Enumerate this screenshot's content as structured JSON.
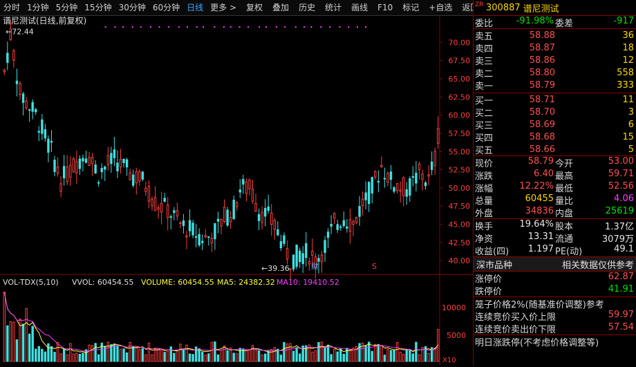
{
  "toolbar": {
    "periods": [
      "分时",
      "1分钟",
      "5分钟",
      "15分钟",
      "30分钟",
      "60分钟",
      "日线",
      "更多 >"
    ],
    "active_index": 6,
    "actions": [
      "复权",
      "叠加",
      "历史",
      "统计",
      "画线",
      "F10",
      "标记",
      "+自选",
      "返回"
    ]
  },
  "chart": {
    "title": "谱尼测试(日线,前复权)",
    "high_label": "72.44",
    "low_label": "39.36",
    "price_ticks": [
      "70.00",
      "67.50",
      "65.00",
      "62.50",
      "60.00",
      "57.50",
      "55.00",
      "52.50",
      "50.00",
      "47.50",
      "45.00",
      "42.50",
      "40.00"
    ],
    "marker_cai": "财",
    "marker_s": "S",
    "colors": {
      "up": "#ff4040",
      "down": "#40e0e0",
      "ma5": "#ffff40",
      "ma10": "#ff40ff",
      "axis": "#8b0000"
    }
  },
  "volume": {
    "indicator": "VOL-TDX(5,10)",
    "vvol_label": "VVOL: 60454.55",
    "volume_label": "VOLUME: 60454.55",
    "ma5_label": "MA5: 24382.32",
    "ma10_label": "MA10: 19410.52",
    "ticks": [
      "10000",
      "5000"
    ],
    "unit": "X10"
  },
  "quote": {
    "zr": "ZR",
    "code": "300887",
    "name": "谱尼测试",
    "weibi_label": "委比",
    "weibi_value": "-91.98%",
    "weicha_label": "委差",
    "weicha_value": "-917",
    "asks": [
      {
        "label": "卖五",
        "price": "58.88",
        "vol": "36"
      },
      {
        "label": "卖四",
        "price": "58.87",
        "vol": "18"
      },
      {
        "label": "卖三",
        "price": "58.86",
        "vol": "12"
      },
      {
        "label": "卖二",
        "price": "58.80",
        "vol": "558"
      },
      {
        "label": "卖一",
        "price": "58.79",
        "vol": "333"
      }
    ],
    "bids": [
      {
        "label": "买一",
        "price": "58.71",
        "vol": "11"
      },
      {
        "label": "买二",
        "price": "58.70",
        "vol": "3"
      },
      {
        "label": "买三",
        "price": "58.69",
        "vol": "6"
      },
      {
        "label": "买四",
        "price": "58.68",
        "vol": "15"
      },
      {
        "label": "买五",
        "price": "58.66",
        "vol": "5"
      }
    ],
    "stats1": [
      {
        "l": "现价",
        "lv": "58.79",
        "lc": "red",
        "r": "今开",
        "rv": "53.00",
        "rc": "red"
      },
      {
        "l": "涨跌",
        "lv": "6.40",
        "lc": "red",
        "r": "最高",
        "rv": "59.71",
        "rc": "red"
      },
      {
        "l": "涨幅",
        "lv": "12.22%",
        "lc": "red",
        "r": "最低",
        "rv": "52.56",
        "rc": "red"
      },
      {
        "l": "总量",
        "lv": "60455",
        "lc": "yellow",
        "r": "量比",
        "rv": "4.06",
        "rc": "magenta"
      },
      {
        "l": "外盘",
        "lv": "34836",
        "lc": "red",
        "r": "内盘",
        "rv": "25619",
        "rc": "green"
      }
    ],
    "stats2": [
      {
        "l": "换手",
        "lv": "19.64%",
        "r": "股本",
        "rv": "1.37亿"
      },
      {
        "l": "净资",
        "lv": "13.31",
        "r": "流通",
        "rv": "3079万"
      },
      {
        "l": "收益(四)",
        "lv": "1.197",
        "r": "PE(动)",
        "rv": "49.1"
      }
    ],
    "band_left": "深市品种",
    "band_right": "相关数据仅供参考",
    "limit_up_label": "涨停价",
    "limit_up": "62.87",
    "limit_down_label": "跌停价",
    "limit_down": "41.91",
    "cage_label": "笼子价格2%(随基准价调整)参考",
    "bid_limit_label": "连续竞价买入价上限",
    "bid_limit": "59.97",
    "ask_limit_label": "连续竞价卖出价下限",
    "ask_limit": "57.54",
    "tomorrow_label": "明日涨跌停(不考虑价格调整等)"
  }
}
